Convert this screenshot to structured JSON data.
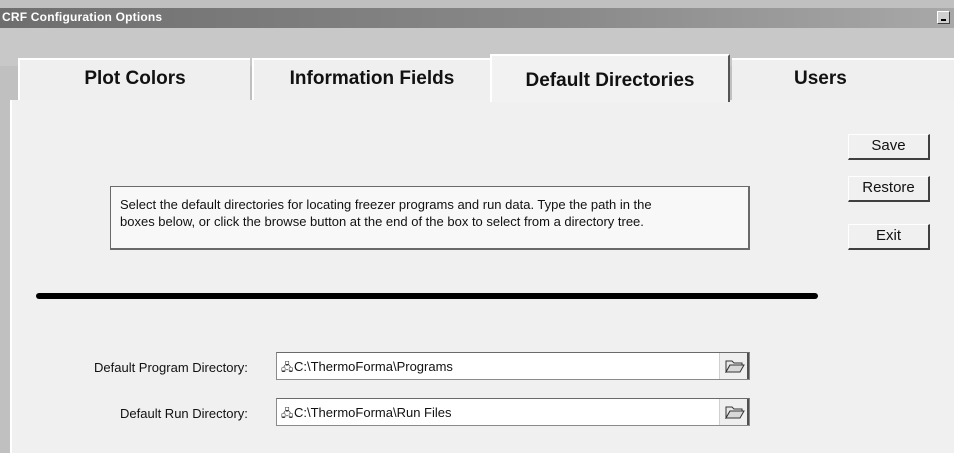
{
  "window": {
    "title": "CRF Configuration Options"
  },
  "tabs": [
    {
      "label": "Plot Colors",
      "active": false
    },
    {
      "label": "Information Fields",
      "active": false
    },
    {
      "label": "Default Directories",
      "active": true
    },
    {
      "label": "Users",
      "active": false
    }
  ],
  "buttons": {
    "save": "Save",
    "restore": "Restore",
    "exit": "Exit"
  },
  "info": {
    "line1": "Select the default directories for locating freezer programs and run data.  Type the path in the",
    "line2": "boxes below, or click the browse button at the end of the box to select from a directory tree."
  },
  "fields": {
    "program": {
      "label": "Default Program Directory:",
      "value": "C:\\ThermoForma\\Programs"
    },
    "run": {
      "label": "Default Run Directory:",
      "value": "C:\\ThermoForma\\Run Files"
    }
  },
  "icons": {
    "tree": "directory-tree-icon",
    "browse": "folder-open-icon",
    "minimize": "minimize-icon"
  }
}
